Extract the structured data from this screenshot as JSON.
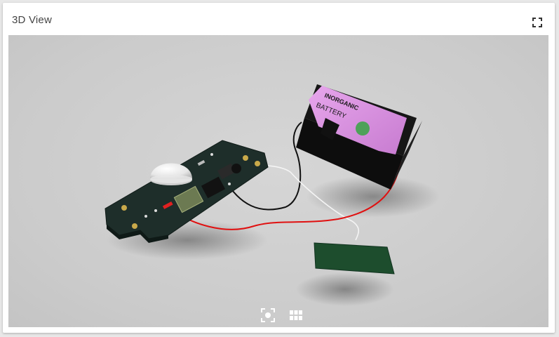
{
  "panel": {
    "title": "3D View"
  },
  "battery": {
    "line1": "INORGANIC",
    "line2": "BATTERY"
  },
  "icons": {
    "fullscreen": "fullscreen-icon",
    "focus": "focus-view-icon",
    "grid": "grid-view-icon"
  },
  "colors": {
    "battery_label": "#d98be0",
    "pcb": "#1e2e2a",
    "antenna": "#1d4d2d",
    "wire_red": "#e01010",
    "wire_black": "#111111",
    "wire_white": "#f4f4f4"
  }
}
